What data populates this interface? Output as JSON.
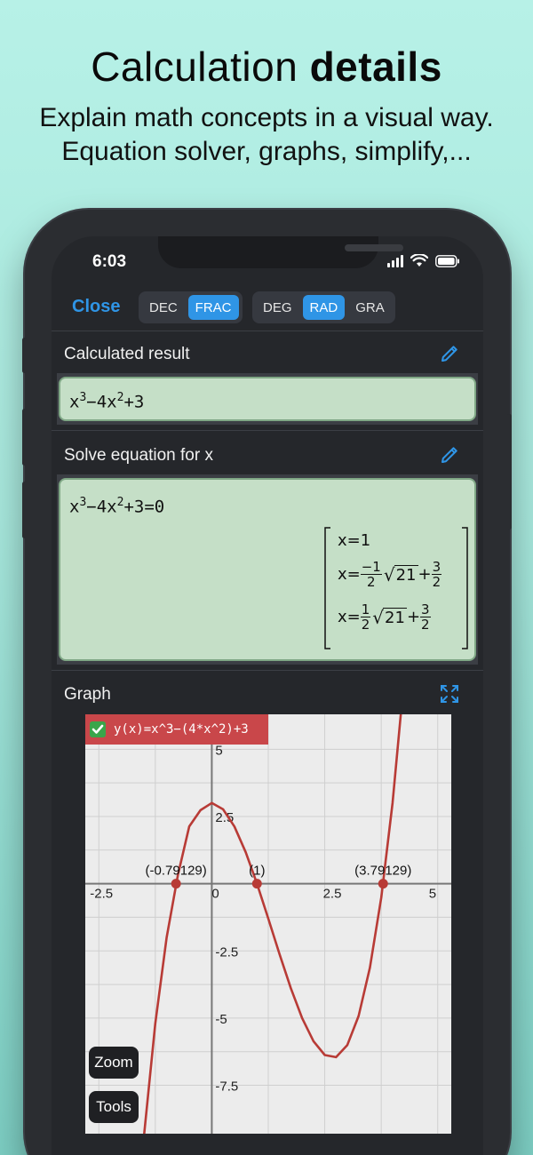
{
  "promo": {
    "headline_regular": "Calculation",
    "headline_bold": "details",
    "subline_1": "Explain math concepts in a visual way.",
    "subline_2": "Equation solver, graphs, simplify,..."
  },
  "status_bar": {
    "time": "6:03"
  },
  "toolbar": {
    "close_label": "Close",
    "number_format": {
      "options": [
        "DEC",
        "FRAC"
      ],
      "selected": "FRAC"
    },
    "angle_unit": {
      "options": [
        "DEG",
        "RAD",
        "GRA"
      ],
      "selected": "RAD"
    }
  },
  "calculated": {
    "title": "Calculated result",
    "expression_parts": [
      "x",
      "3",
      "−4x",
      "2",
      "+3"
    ]
  },
  "solve": {
    "title": "Solve equation for x",
    "equation_parts": [
      "x",
      "3",
      "−4x",
      "2",
      "+3=0"
    ],
    "solutions": {
      "s1": "x=1",
      "s2_prefix": "x=",
      "s2_num": "−1",
      "s2_den": "2",
      "s2_root": "21",
      "s2_plus": "+",
      "s2_num2": "3",
      "s2_den2": "2",
      "s3_prefix": "x=",
      "s3_num": "1",
      "s3_den": "2",
      "s3_root": "21",
      "s3_plus": "+",
      "s3_num2": "3",
      "s3_den2": "2"
    }
  },
  "graph": {
    "title": "Graph",
    "legend": "y(x)=x^3−(4*x^2)+3",
    "zoom_label": "Zoom",
    "tools_label": "Tools",
    "colors": {
      "curve": "#b83b36",
      "legend_bg": "#c9474a",
      "grid": "#cfcfcf",
      "axis": "#777777"
    }
  },
  "chart_data": {
    "type": "line",
    "title": "",
    "xlabel": "",
    "ylabel": "",
    "xlim": [
      -2.8,
      5.3
    ],
    "ylim": [
      -9.3,
      6.3
    ],
    "grid": true,
    "x_ticks": [
      -2.5,
      0,
      2.5,
      5
    ],
    "x_tick_labels": [
      "-2.5",
      "0",
      "2.5",
      "5"
    ],
    "y_ticks": [
      5,
      2.5,
      -2.5,
      -5,
      -7.5
    ],
    "y_tick_labels": [
      "5",
      "2.5",
      "-2.5",
      "-5",
      "-7.5"
    ],
    "series": [
      {
        "name": "y(x)=x^3−(4*x^2)+3",
        "x": [
          -1.5,
          -1.25,
          -1.0,
          -0.75,
          -0.5,
          -0.25,
          0.0,
          0.25,
          0.5,
          0.75,
          1.0,
          1.25,
          1.5,
          1.75,
          2.0,
          2.25,
          2.5,
          2.75,
          3.0,
          3.25,
          3.5,
          3.75,
          4.0,
          4.25
        ],
        "y": [
          -9.375,
          -5.203,
          -2.0,
          0.328,
          2.125,
          2.734,
          3.0,
          2.766,
          2.125,
          1.172,
          0.0,
          -1.297,
          -2.625,
          -3.891,
          -5.0,
          -5.859,
          -6.375,
          -6.453,
          -6.0,
          -4.922,
          -3.125,
          -0.516,
          3.0,
          7.516
        ]
      }
    ],
    "marked_points": [
      {
        "x": -0.79129,
        "y": 0,
        "label": "(-0.79129)"
      },
      {
        "x": 1,
        "y": 0,
        "label": "(1)"
      },
      {
        "x": 3.79129,
        "y": 0,
        "label": "(3.79129)"
      }
    ]
  }
}
